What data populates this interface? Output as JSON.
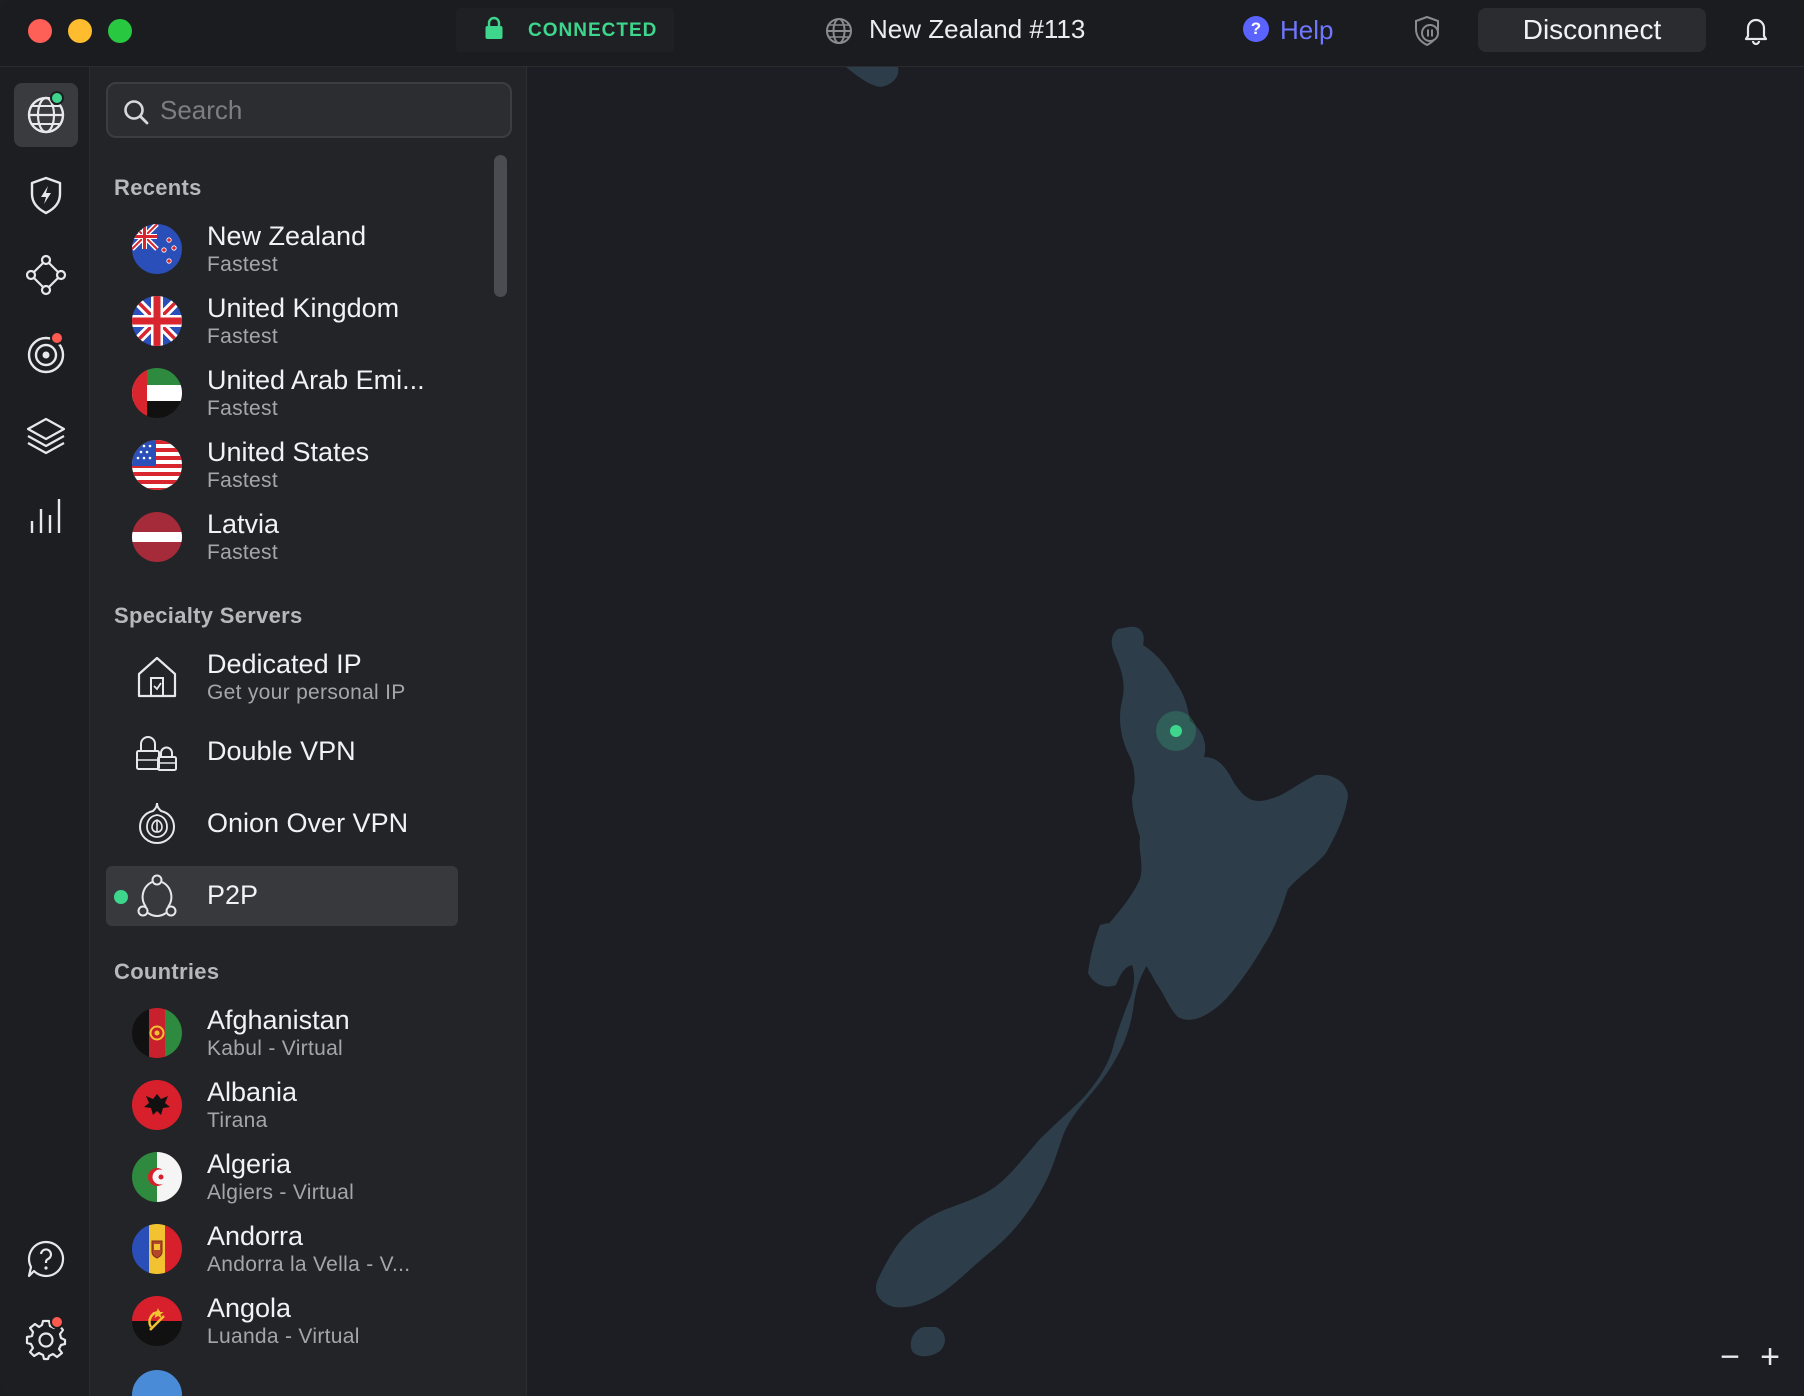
{
  "titlebar": {
    "status": "CONNECTED",
    "server": "New Zealand #113",
    "help_label": "Help",
    "help_glyph": "?",
    "disconnect_label": "Disconnect"
  },
  "rail": {
    "items": [
      {
        "icon": "globe-icon",
        "active": true,
        "badge_color": "#3dd68c"
      },
      {
        "icon": "shield-bolt-icon"
      },
      {
        "icon": "meshnet-icon"
      },
      {
        "icon": "target-icon",
        "badge_color": "#ff5a4f"
      },
      {
        "icon": "layers-icon"
      },
      {
        "icon": "stats-bars-icon"
      },
      {
        "icon": "help-chat-icon"
      },
      {
        "icon": "gear-icon",
        "badge_color": "#ff5a4f"
      }
    ]
  },
  "search": {
    "placeholder": "Search",
    "value": ""
  },
  "recents": {
    "label": "Recents",
    "items": [
      {
        "name": "New Zealand",
        "sub": "Fastest",
        "flag": "nz-flag-icon"
      },
      {
        "name": "United Kingdom",
        "sub": "Fastest",
        "flag": "uk-flag-icon"
      },
      {
        "name": "United Arab Emi...",
        "sub": "Fastest",
        "flag": "uae-flag-icon"
      },
      {
        "name": "United States",
        "sub": "Fastest",
        "flag": "us-flag-icon"
      },
      {
        "name": "Latvia",
        "sub": "Fastest",
        "flag": "latvia-flag-icon"
      }
    ]
  },
  "specialty": {
    "label": "Specialty Servers",
    "items": [
      {
        "name": "Dedicated IP",
        "sub": "Get your personal IP",
        "icon": "house-icon"
      },
      {
        "name": "Double VPN",
        "icon": "double-lock-icon"
      },
      {
        "name": "Onion Over VPN",
        "icon": "onion-icon"
      },
      {
        "name": "P2P",
        "icon": "p2p-icon",
        "selected": true
      }
    ]
  },
  "countries": {
    "label": "Countries",
    "items": [
      {
        "name": "Afghanistan",
        "sub": "Kabul - Virtual",
        "flag": "afghanistan-flag-icon"
      },
      {
        "name": "Albania",
        "sub": "Tirana",
        "flag": "albania-flag-icon"
      },
      {
        "name": "Algeria",
        "sub": "Algiers - Virtual",
        "flag": "algeria-flag-icon"
      },
      {
        "name": "Andorra",
        "sub": "Andorra la Vella - V...",
        "flag": "andorra-flag-icon"
      },
      {
        "name": "Angola",
        "sub": "Luanda - Virtual",
        "flag": "angola-flag-icon"
      }
    ]
  },
  "map": {
    "region": "New Zealand",
    "land_color": "#2d3d4a",
    "marker_color": "#3dd68c",
    "zoom_out": "−",
    "zoom_in": "+"
  },
  "colors": {
    "accent_green": "#3dd68c",
    "help_blue": "#6f76ff",
    "alert_red": "#ff5a4f"
  }
}
